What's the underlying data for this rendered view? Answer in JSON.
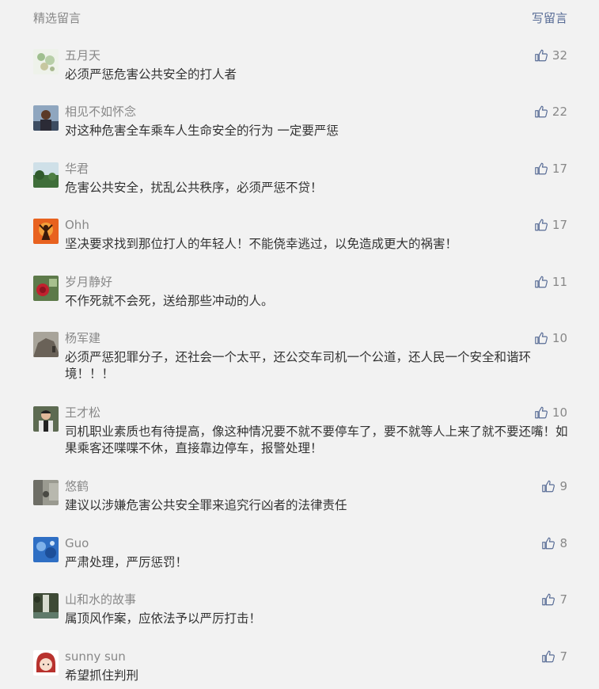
{
  "header": {
    "title": "精选留言",
    "write_label": "写留言"
  },
  "comments": [
    {
      "nickname": "五月天",
      "likes": "32",
      "content": "必须严惩危害公共安全的打人者",
      "avatar_icon": "flower-avatar-icon",
      "avatar_color": "#c9d6c0"
    },
    {
      "nickname": "相见不如怀念",
      "likes": "22",
      "content": "对这种危害全车乘车人生命安全的行为  一定要严惩",
      "avatar_icon": "man-portrait-avatar-icon",
      "avatar_color": "#6a7f95"
    },
    {
      "nickname": "华君",
      "likes": "17",
      "content": "危害公共安全，扰乱公共秩序，必须严惩不贷！",
      "avatar_icon": "landscape-avatar-icon",
      "avatar_color": "#4e7a48"
    },
    {
      "nickname": "Ohh",
      "likes": "17",
      "content": "坚决要求找到那位打人的年轻人！不能侥幸逃过，以免造成更大的祸害！",
      "avatar_icon": "silhouette-avatar-icon",
      "avatar_color": "#e05a1e"
    },
    {
      "nickname": "岁月静好",
      "likes": "11",
      "content": "不作死就不会死，送给那些冲动的人。",
      "avatar_icon": "rose-avatar-icon",
      "avatar_color": "#b3202a"
    },
    {
      "nickname": "杨军建",
      "likes": "10",
      "content": "必须严惩犯罪分子，还社会一个太平，还公交车司机一个公道，还人民一个安全和谐环境！！！",
      "avatar_icon": "rock-avatar-icon",
      "avatar_color": "#7d7468"
    },
    {
      "nickname": "王才松",
      "likes": "10",
      "content": "司机职业素质也有待提高，像这种情况要不就不要停车了，要不就等人上来了就不要还嘴！如果乘客还喋喋不休，直接靠边停车，报警处理！",
      "avatar_icon": "person-avatar-icon",
      "avatar_color": "#3c4a38"
    },
    {
      "nickname": "悠鹤",
      "likes": "9",
      "content": "建议以涉嫌危害公共安全罪来追究行凶者的法律责任",
      "avatar_icon": "street-avatar-icon",
      "avatar_color": "#8a8a80"
    },
    {
      "nickname": "Guo",
      "likes": "8",
      "content": "严肃处理，严厉惩罚！",
      "avatar_icon": "sky-avatar-icon",
      "avatar_color": "#2f6fc4"
    },
    {
      "nickname": "山和水的故事",
      "likes": "7",
      "content": "属顶风作案，应依法予以严厉打击！",
      "avatar_icon": "waterfall-avatar-icon",
      "avatar_color": "#3e4a36"
    },
    {
      "nickname": "sunny sun",
      "likes": "7",
      "content": "希望抓住判刑",
      "avatar_icon": "cartoon-girl-avatar-icon",
      "avatar_color": "#f4d8c8"
    }
  ]
}
